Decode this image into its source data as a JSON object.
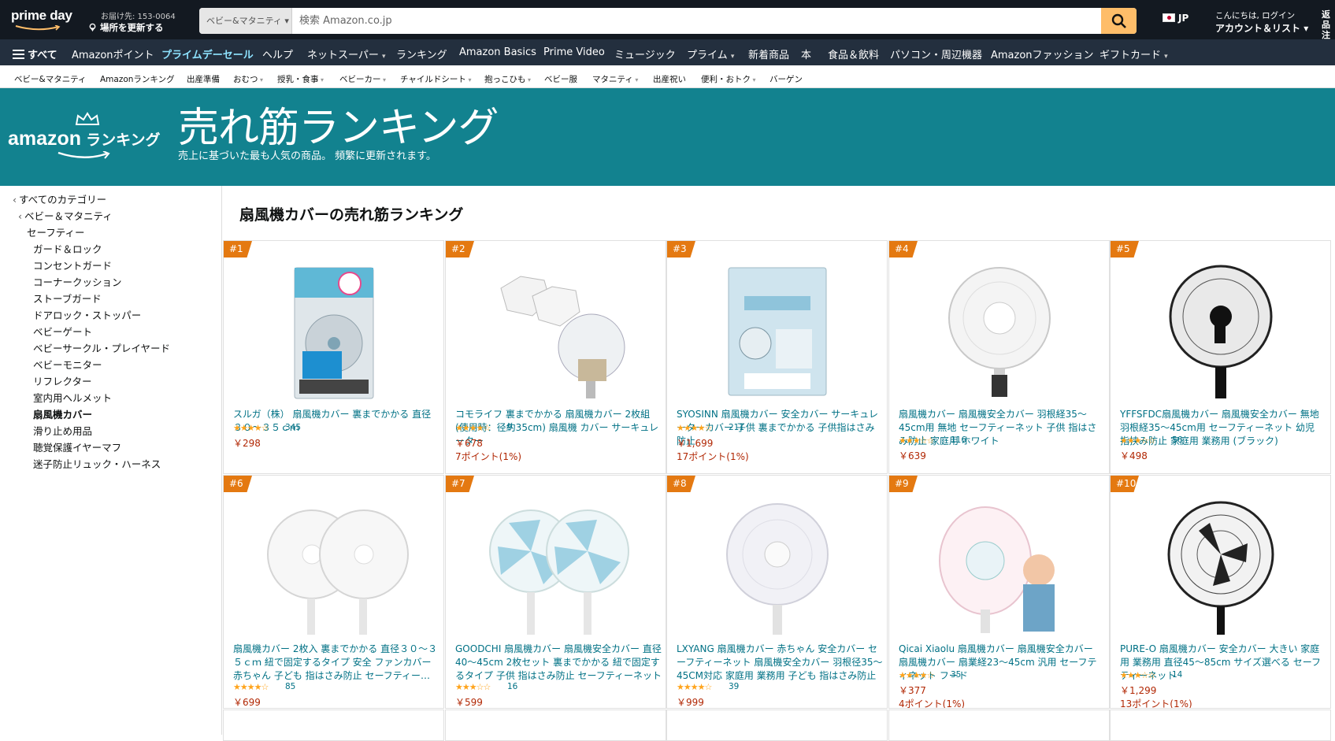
{
  "header": {
    "logo_text": "prime day",
    "deliver_line1": "お届け先: 153-0064",
    "deliver_line2": "場所を更新する",
    "search_dept": "ベビー&マタニティ",
    "search_placeholder": "検索 Amazon.co.jp",
    "lang": "JP",
    "account_line1": "こんにちは, ログイン",
    "account_line2": "アカウント＆リスト",
    "returns_line1": "返品",
    "returns_line2": "注文"
  },
  "nav": {
    "all": "すべて",
    "items": [
      "Amazonポイント",
      "プライムデーセール",
      "ヘルプ",
      "ネットスーパー",
      "ランキング",
      "Amazon Basics",
      "Prime Video",
      "ミュージック",
      "プライム",
      "新着商品",
      "本",
      "食品＆飲料",
      "パソコン・周辺機器",
      "Amazonファッション",
      "ギフトカード"
    ]
  },
  "subnav": {
    "items": [
      "ベビー&マタニティ",
      "Amazonランキング",
      "出産準備",
      "おむつ",
      "授乳・食事",
      "ベビーカー",
      "チャイルドシート",
      "抱っこひも",
      "ベビー服",
      "マタニティ",
      "出産祝い",
      "便利・おトク",
      "バーゲン"
    ]
  },
  "hero": {
    "brand_left": "amazon",
    "brand_right": "ランキング",
    "title": "売れ筋ランキング",
    "subtitle": "売上に基づいた最も人気の商品。 頻繁に更新されます。"
  },
  "sidebar": {
    "all_categories": "すべてのカテゴリー",
    "parent": "ベビー＆マタニティ",
    "current_parent": "セーフティー",
    "children": [
      "ガード＆ロック",
      "コンセントガード",
      "コーナークッション",
      "ストーブガード",
      "ドアロック・ストッパー",
      "ベビーゲート",
      "ベビーサークル・プレイヤード",
      "ベビーモニター",
      "リフレクター",
      "室内用ヘルメット",
      "扇風機カバー",
      "滑り止め用品",
      "聴覚保護イヤーマフ",
      "迷子防止リュック・ハーネス"
    ],
    "selected": "扇風機カバー"
  },
  "main": {
    "heading": "扇風機カバーの売れ筋ランキング",
    "products": [
      {
        "rank": "#1",
        "title": "スルガ（株） 扇風機カバー 裏までかかる 直径３０～３５ｃｍ",
        "stars": "★★★★☆",
        "count": "345",
        "price": "￥298",
        "points": "",
        "image": "fan-cover-package"
      },
      {
        "rank": "#2",
        "title": "コモライフ 裏までかかる 扇風機カバー 2枚組(使用時：径約35cm) 扇風機 カバー サーキュレーター",
        "stars": "★★★★☆",
        "count": "9",
        "price": "￥678",
        "points": "7ポイント(1%)",
        "image": "mesh-fan-cover"
      },
      {
        "rank": "#3",
        "title": "SYOSINN 扇風機カバー 安全カバー サーキュレーターカバー 子供 裏までかかる 子供指はさみ防止",
        "stars": "★★★★☆",
        "count": "211",
        "price": "￥1,699",
        "points": "17ポイント(1%)",
        "image": "fan-cover-bag"
      },
      {
        "rank": "#4",
        "title": "扇風機カバー 扇風機安全カバー 羽根経35～45cm用 無地 セーフティーネット 子供 指はさみ防止 家庭用 ホワイト",
        "stars": "★★★☆☆",
        "count": "116",
        "price": "￥639",
        "points": "",
        "image": "white-fan-covered"
      },
      {
        "rank": "#5",
        "title": "YFFSFDC扇風機カバー 扇風機安全カバー 無地 羽根経35～45cm用 セーフティーネット 幼児 指挟み防止 家庭用 業務用 (ブラック)",
        "stars": "★★★☆☆",
        "count": "56",
        "price": "￥498",
        "points": "",
        "image": "black-fan-covered"
      },
      {
        "rank": "#6",
        "title": "扇風機カバー 2枚入 裏までかかる 直径３０～３５ｃｍ 紐で固定するタイプ 安全 ファンカバー 赤ちゃん 子ども 指はさみ防止 セーフティーネット",
        "stars": "★★★★☆",
        "count": "85",
        "price": "￥699",
        "points": "",
        "image": "two-white-fans"
      },
      {
        "rank": "#7",
        "title": "GOODCHI 扇風機カバー 扇風機安全カバー 直径40～45cm 2枚セット 裏までかかる 紐で固定するタイプ 子供 指はさみ防止 セーフティーネット",
        "stars": "★★★☆☆",
        "count": "16",
        "price": "￥599",
        "points": "",
        "image": "two-blue-fans"
      },
      {
        "rank": "#8",
        "title": "LXYANG 扇風機カバー 赤ちゃん 安全カバー セーフティーネット 扇風機安全カバー 羽根径35～45CM対応 家庭用 業務用 子ども 指はさみ防止",
        "stars": "★★★★☆",
        "count": "39",
        "price": "￥999",
        "points": "",
        "image": "white-fan-net"
      },
      {
        "rank": "#9",
        "title": "Qicai Xiaolu 扇風機カバー 扇風機安全カバー 扇風機カバー 扇業経23～45cm 汎用 セーフティネット フード",
        "stars": "★★★★☆",
        "count": "35",
        "price": "￥377",
        "points": "4ポイント(1%)",
        "image": "fan-with-child"
      },
      {
        "rank": "#10",
        "title": "PURE-O 扇風機カバー 安全カバー 大きい 家庭用 業務用 直径45～85cm サイズ選べる セーフティーネット",
        "stars": "★★★☆☆",
        "count": "14",
        "price": "￥1,299",
        "points": "13ポイント(1%)",
        "image": "large-black-fan"
      }
    ]
  }
}
